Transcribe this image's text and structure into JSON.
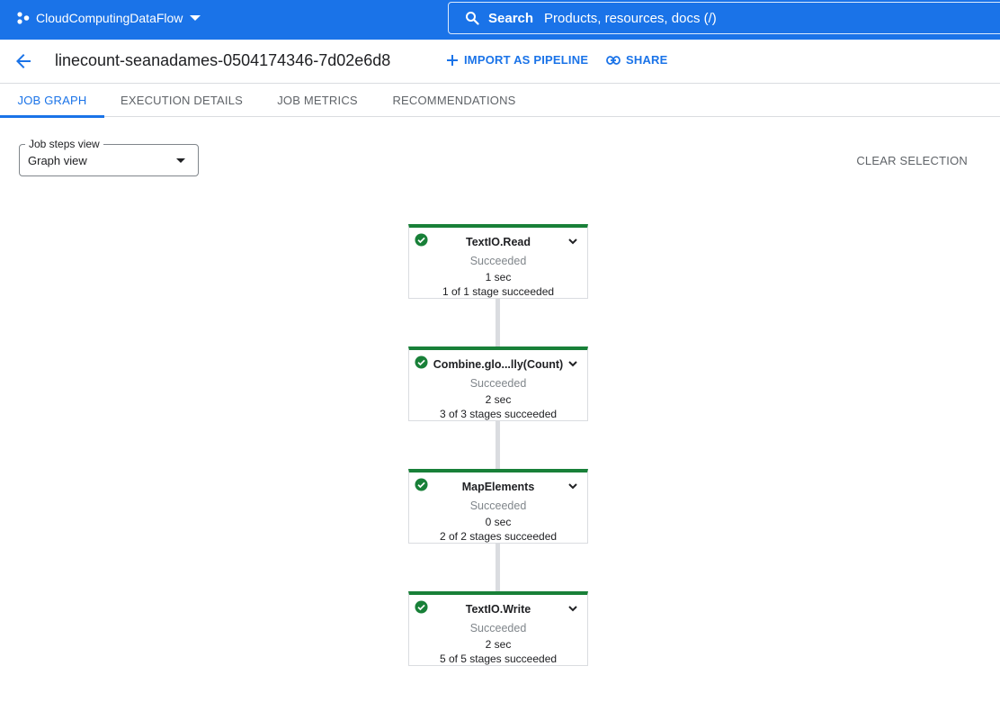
{
  "topbar": {
    "project_name": "CloudComputingDataFlow",
    "search_label": "Search",
    "search_placeholder": "Products, resources, docs (/)"
  },
  "header": {
    "job_title": "linecount-seanadames-0504174346-7d02e6d8",
    "import_label": "IMPORT AS PIPELINE",
    "share_label": "SHARE"
  },
  "tabs": [
    {
      "label": "JOB GRAPH",
      "active": true
    },
    {
      "label": "EXECUTION DETAILS",
      "active": false
    },
    {
      "label": "JOB METRICS",
      "active": false
    },
    {
      "label": "RECOMMENDATIONS",
      "active": false
    }
  ],
  "view_select": {
    "legend": "Job steps view",
    "value": "Graph view"
  },
  "clear_selection_label": "CLEAR SELECTION",
  "colors": {
    "brand": "#1a73e8",
    "success": "#188038"
  },
  "graph": {
    "nodes": [
      {
        "name": "TextIO.Read",
        "status": "Succeeded",
        "duration": "1 sec",
        "stages": "1 of 1 stage succeeded",
        "icon": "check-circle-icon"
      },
      {
        "name": "Combine.glo...lly(Count)",
        "status": "Succeeded",
        "duration": "2 sec",
        "stages": "3 of 3 stages succeeded",
        "icon": "check-circle-icon"
      },
      {
        "name": "MapElements",
        "status": "Succeeded",
        "duration": "0 sec",
        "stages": "2 of 2 stages succeeded",
        "icon": "check-circle-icon"
      },
      {
        "name": "TextIO.Write",
        "status": "Succeeded",
        "duration": "2 sec",
        "stages": "5 of 5 stages succeeded",
        "icon": "check-circle-icon"
      }
    ]
  }
}
